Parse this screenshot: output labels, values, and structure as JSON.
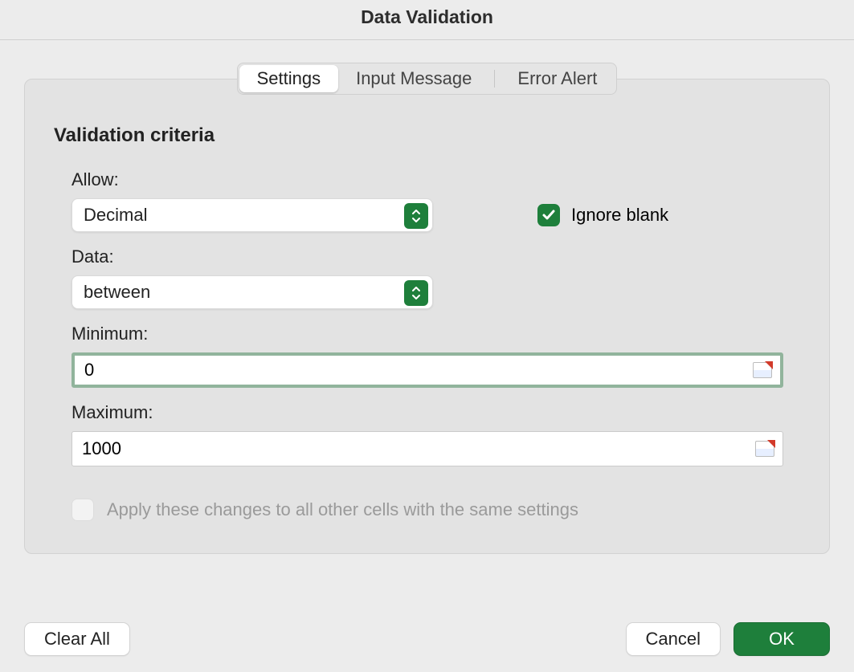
{
  "dialog": {
    "title": "Data Validation"
  },
  "tabs": {
    "settings": "Settings",
    "input_message": "Input Message",
    "error_alert": "Error Alert"
  },
  "panel": {
    "heading": "Validation criteria",
    "allow_label": "Allow:",
    "allow_value": "Decimal",
    "ignore_blank_label": "Ignore blank",
    "ignore_blank_checked": true,
    "data_label": "Data:",
    "data_value": "between",
    "minimum_label": "Minimum:",
    "minimum_value": "0",
    "maximum_label": "Maximum:",
    "maximum_value": "1000",
    "apply_label": "Apply these changes to all other cells with the same settings",
    "apply_checked": false
  },
  "footer": {
    "clear_all": "Clear All",
    "cancel": "Cancel",
    "ok": "OK"
  },
  "colors": {
    "accent": "#1e7f3b"
  }
}
